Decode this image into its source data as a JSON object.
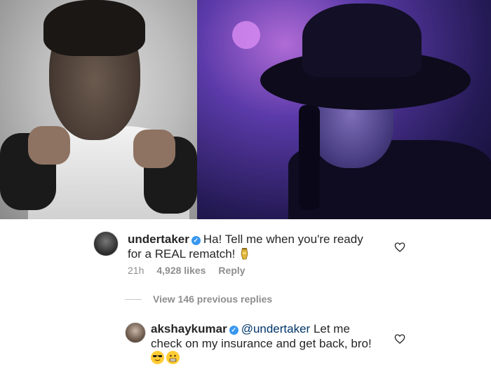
{
  "comments": [
    {
      "username": "undertaker",
      "text_line1": "Ha! Tell me when you're ready",
      "text_line2": "for a REAL rematch!",
      "emoji_icon": "urn-icon",
      "time": "21h",
      "likes": "4,928 likes",
      "reply_label": "Reply"
    },
    {
      "username": "akshaykumar",
      "mention": "@undertaker",
      "text_line1_rest": "Let me",
      "text_line2": "check on my insurance and get back, bro!",
      "emoji_icons": [
        "sunglasses-face-icon",
        "grimacing-face-icon"
      ]
    }
  ],
  "view_replies": "View 146 previous replies",
  "colors": {
    "verified": "#3897f0",
    "mention": "#003569",
    "meta": "#8e8e8e"
  }
}
